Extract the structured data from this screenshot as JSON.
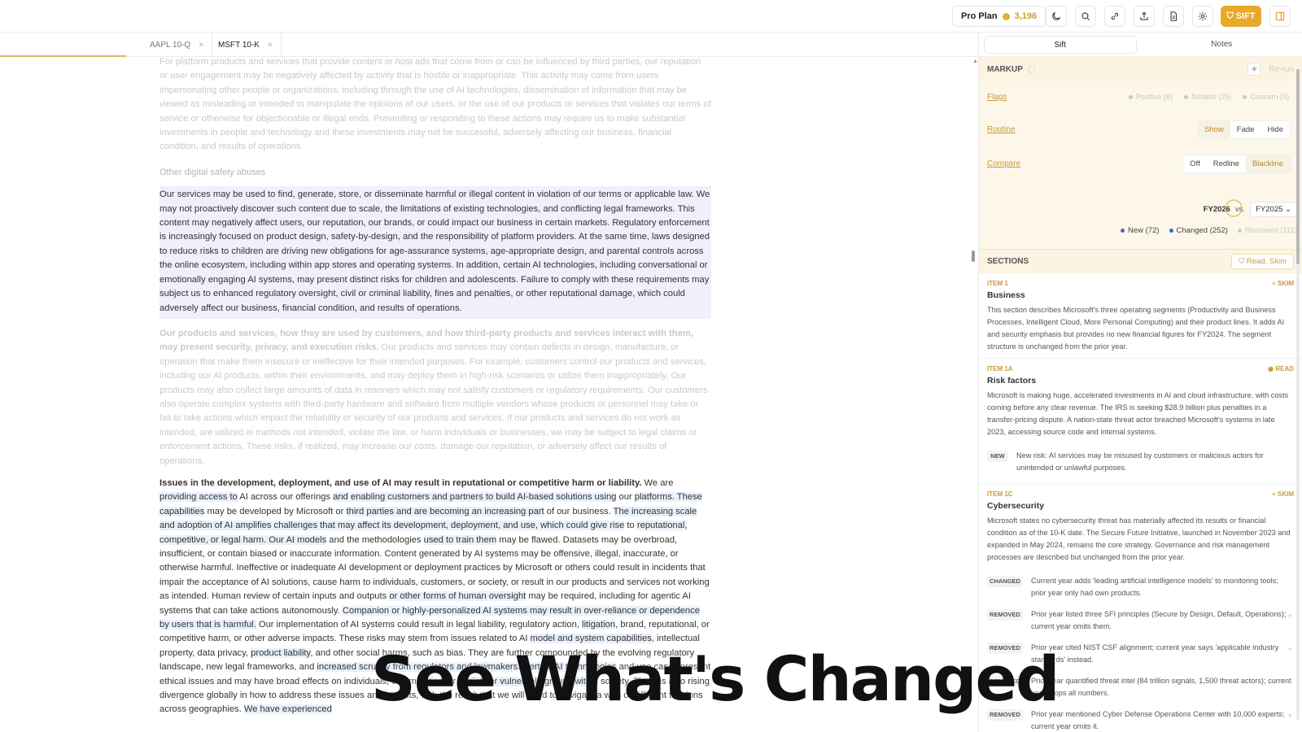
{
  "topbar": {
    "plan_label": "Pro Plan",
    "credits": "3,196",
    "sift_label": "SIFT",
    "icons": [
      "moon-icon",
      "search-icon",
      "link-icon",
      "share-icon",
      "document-icon",
      "gear-icon"
    ]
  },
  "tabs": [
    {
      "label": "AAPL 10-Q",
      "close": "×"
    },
    {
      "label": "MSFT 10-K",
      "close": "×"
    }
  ],
  "document": {
    "para1": "For platform products and services that provide content or host ads that come from or can be influenced by third parties, our reputation or user engagement may be negatively affected by activity that is hostile or inappropriate. This activity may come from users impersonating other people or organizations, including through the use of AI technologies, dissemination of information that may be viewed as misleading or intended to manipulate the opinions of our users, or the use of our products or services that violates our terms of service or otherwise for objectionable or illegal ends. Preventing or responding to these actions may require us to make substantial investments in people and technology and these investments may not be successful, adversely affecting our business, financial condition, and results of operations.",
    "heading": "Other digital safety abuses",
    "para2": "Our services may be used to find, generate, store, or disseminate harmful or illegal content in violation of our terms or applicable law. We may not proactively discover such content due to scale, the limitations of existing technologies, and conflicting legal frameworks. This content may negatively affect users, our reputation, our brands, or could impact our business in certain markets. Regulatory enforcement is increasingly focused on product design, safety-by-design, and the responsibility of platform providers. At the same time, laws designed to reduce risks to children are driving new obligations for age-assurance systems, age-appropriate design, and parental controls across the online ecosystem, including within app stores and operating systems. In addition, certain AI technologies, including conversational or emotionally engaging AI systems, may present distinct risks for children and adolescents. Failure to comply with these requirements may subject us to enhanced regulatory oversight, civil or criminal liability, fines and penalties, or other reputational damage, which could adversely affect our business, financial condition, and results of operations.",
    "para3_lead": "Our products and services, how they are used by customers, and how third-party products and services interact with them, may present security, privacy, and execution risks.",
    "para3_rest": " Our products and services may contain defects in design, manufacture, or operation that make them insecure or ineffective for their intended purposes. For example, customers control our products and services, including our AI products, within their environments, and may deploy them in high-risk scenarios or utilize them inappropriately. Our products may also collect large amounts of data in manners which may not satisfy customers or regulatory requirements. Our customers also operate complex systems with third-party hardware and software from multiple vendors whose products or personnel may take or fail to take actions which impact the reliability or security of our products and services. If our products and services do not work as intended, are utilized in methods not intended, violate the law, or harm individuals or businesses, we may be subject to legal claims or enforcement actions. These risks, if realized, may increase our costs, damage our reputation, or adversely affect our results of operations.",
    "para4": [
      {
        "t": "Issues in the development, deployment, and use of AI may result in reputational or competitive harm or liability.",
        "k": "lead"
      },
      {
        "t": " We are ",
        "k": "n"
      },
      {
        "t": "providing access to",
        "k": "m"
      },
      {
        "t": " AI across our offerings ",
        "k": "n"
      },
      {
        "t": "and enabling customers and partners to build AI-based solutions using",
        "k": "m"
      },
      {
        "t": " our ",
        "k": "n"
      },
      {
        "t": "platforms. These capabilities",
        "k": "m"
      },
      {
        "t": " may be developed by Microsoft or ",
        "k": "n"
      },
      {
        "t": "third parties and are becoming an increasing part",
        "k": "m"
      },
      {
        "t": " of our business. ",
        "k": "n"
      },
      {
        "t": "The increasing scale and adoption of AI amplifies challenges that may affect its development, deployment, and use, which could give rise",
        "k": "m"
      },
      {
        "t": " to ",
        "k": "n"
      },
      {
        "t": "reputational, competitive, or legal harm. Our AI models",
        "k": "m"
      },
      {
        "t": " and the methodologies ",
        "k": "n"
      },
      {
        "t": "used to train them",
        "k": "m"
      },
      {
        "t": " may be flawed. Datasets may be overbroad, insufficient, or contain biased or inaccurate information. Content generated by AI systems may be offensive, illegal, inaccurate, or otherwise harmful. Ineffective or inadequate AI development or deployment practices by Microsoft or others could result in incidents that impair the acceptance of AI solutions, cause harm to individuals, customers, or society, or result in our products and services not working as intended. Human review of certain inputs and outputs ",
        "k": "n"
      },
      {
        "t": "or other forms of human oversight",
        "k": "m"
      },
      {
        "t": " may be required, including for agentic AI systems that can take actions autonomously. ",
        "k": "n"
      },
      {
        "t": "Companion or highly-personalized AI systems may result in over-reliance or dependence by users that is harmful.",
        "k": "m"
      },
      {
        "t": " Our implementation of AI systems could result in legal liability, regulatory action, ",
        "k": "n"
      },
      {
        "t": "litigation",
        "k": "m"
      },
      {
        "t": ", brand, reputational, or competitive harm, or other adverse impacts. These risks may stem from issues related to AI ",
        "k": "n"
      },
      {
        "t": "model and system capabilities",
        "k": "m"
      },
      {
        "t": ", intellectual property, data privacy, ",
        "k": "n"
      },
      {
        "t": "product liability",
        "k": "m"
      },
      {
        "t": ", and other social harms, such as bias. They are further compounded by the evolving regulatory landscape, new legal frameworks, and ",
        "k": "n"
      },
      {
        "t": "increased scrutiny from regulators and lawmakers. Certain AI technologies",
        "k": "m"
      },
      {
        "t": " and use cases present ethical issues and may have broad effects on individuals, communities, or ",
        "k": "n"
      },
      {
        "t": "society or vulnerable groups within",
        "k": "m"
      },
      {
        "t": " society. There is also rising divergence globally in how to address these issues and impacts, with the result that we will need to navigate a web of different tensions across geographies. ",
        "k": "n"
      },
      {
        "t": "We have experienced",
        "k": "m"
      }
    ]
  },
  "caption": "See What's Changed",
  "right_panel": {
    "tabs": [
      "Sift",
      "Notes"
    ],
    "markup": {
      "title": "MARKUP",
      "rerun": "Re-run",
      "flags_label": "Flags",
      "flags": [
        "Positive (8)",
        "Notable (25)",
        "Concern (5)"
      ],
      "routine_label": "Routine",
      "routine_opts": [
        "Show",
        "Fade",
        "Hide"
      ],
      "compare_label": "Compare",
      "compare_opts": [
        "Off",
        "Redline",
        "Blackline"
      ],
      "year_a": "FY2026",
      "vs": "vs.",
      "year_b": "FY2025",
      "legend": [
        "New (72)",
        "Changed (252)",
        "Removed (111)"
      ]
    },
    "sections": {
      "title": "SECTIONS",
      "filter": "Read, Skim",
      "items": [
        {
          "item": "ITEM 1",
          "mode": "SKIM",
          "title": "Business",
          "desc": "This section describes Microsoft's three operating segments (Productivity and Business Processes, Intelligent Cloud, More Personal Computing) and their product lines. It adds AI and security emphasis but provides no new financial figures for FY2024. The segment structure is unchanged from the prior year."
        },
        {
          "item": "ITEM 1A",
          "mode": "READ",
          "title": "Risk factors",
          "desc": "Microsoft is making huge, accelerated investments in AI and cloud infrastructure, with costs coming before any clear revenue. The IRS is seeking $28.9 billion plus penalties in a transfer-pricing dispute. A nation-state threat actor breached Microsoft's systems in late 2023, accessing source code and internal systems."
        },
        {
          "item": "ITEM 1C",
          "mode": "SKIM",
          "title": "Cybersecurity",
          "desc": "Microsoft states no cybersecurity threat has materially affected its results or financial condition as of the 10-K date. The Secure Future Initiative, launched in November 2023 and expanded in May 2024, remains the core strategy. Governance and risk management processes are described but unchanged from the prior year."
        }
      ],
      "new_change": {
        "badge": "NEW",
        "text": "New risk: AI services may be misused by customers or malicious actors for unintended or unlawful purposes."
      },
      "changes": [
        {
          "badge": "CHANGED",
          "text": "Current year adds 'leading artificial intelligence models' to monitoring tools; prior year only had own products."
        },
        {
          "badge": "REMOVED",
          "text": "Prior year listed three SFI principles (Secure by Design, Default, Operations); current year omits them."
        },
        {
          "badge": "REMOVED",
          "text": "Prior year cited NIST CSF alignment; current year says 'applicable industry standards' instead."
        },
        {
          "badge": "REMOVED",
          "text": "Prior year quantified threat intel (84 trillion signals, 1,500 threat actors); current year drops all numbers."
        },
        {
          "badge": "REMOVED",
          "text": "Prior year mentioned Cyber Defense Operations Center with 10,000 experts; current year omits it."
        }
      ]
    }
  }
}
